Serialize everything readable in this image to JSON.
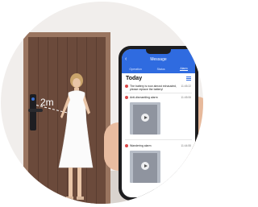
{
  "scene": {
    "distance_label": "2m"
  },
  "app": {
    "header": {
      "title": "Message",
      "tabs": [
        {
          "label": "Operation"
        },
        {
          "label": "Status"
        },
        {
          "label": "Alarm"
        }
      ],
      "active_tab_index": 2,
      "accent_color": "#2f6be0"
    },
    "section_heading": "Today",
    "alerts": [
      {
        "title": "The battery is now almost exhausted, please replace the battery!",
        "time": "11:45:22"
      },
      {
        "title": "Anti-dismantling alarm",
        "time": "11:45:06"
      },
      {
        "title": "Wandering alarm",
        "time": "11:44:55"
      }
    ]
  }
}
